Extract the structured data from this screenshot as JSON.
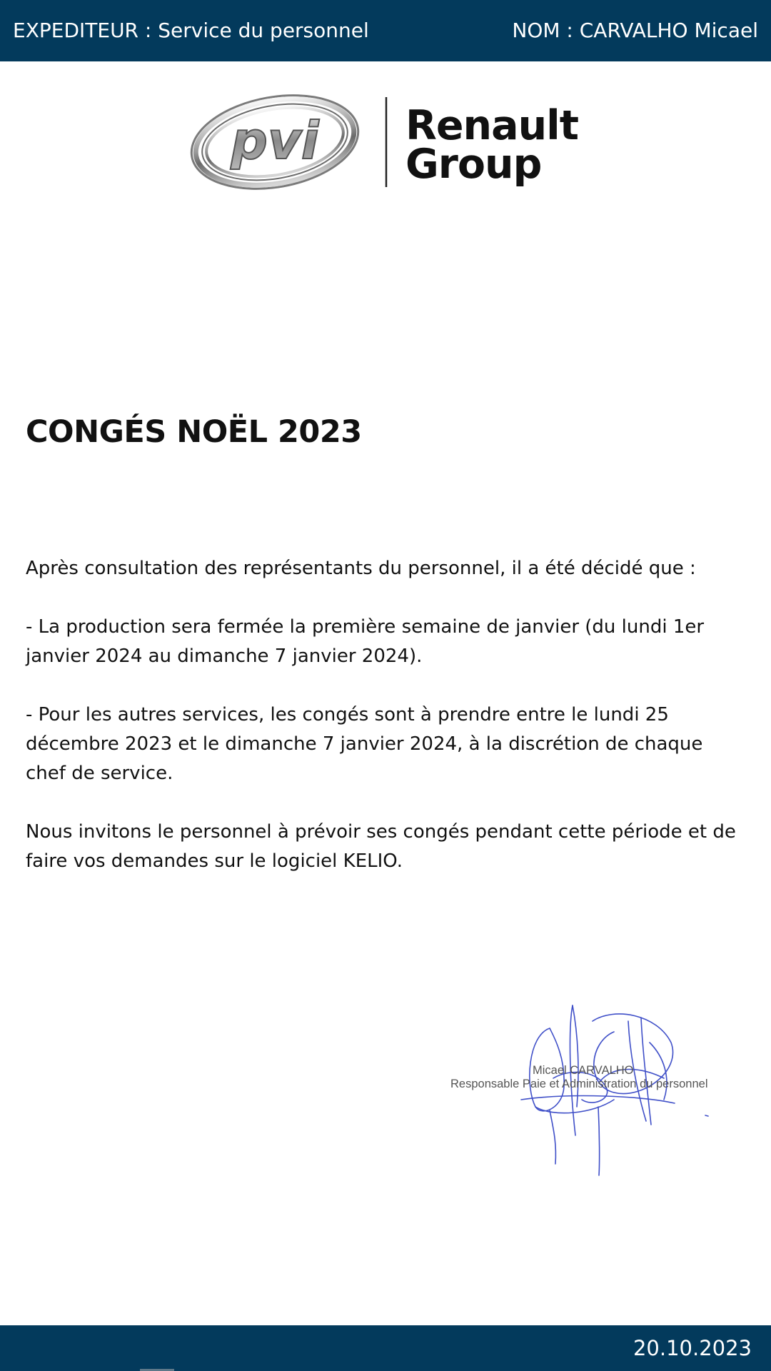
{
  "header": {
    "sender": "EXPEDITEUR : Service du personnel",
    "recipient": "NOM : CARVALHO Micael"
  },
  "logo": {
    "emblem_text": "pvi",
    "brand_line_1": "Renault",
    "brand_line_2": "Group"
  },
  "document": {
    "title": "CONGÉS NOËL 2023",
    "paragraphs": [
      "Après consultation des représentants du personnel, il a été décidé que :",
      "- La production sera fermée la première semaine de janvier (du lundi 1er janvier 2024 au dimanche 7 janvier 2024).",
      "- Pour les autres services, les congés sont à prendre entre le lundi 25 décembre 2023 et le dimanche 7 janvier 2024, à la discrétion de chaque chef de service.",
      "Nous invitons le personnel à prévoir ses congés pendant cette période et de faire vos demandes sur le logiciel KELIO."
    ]
  },
  "signature": {
    "name": "Micael CARVALHO",
    "role": "Responsable Paie et Administration du personnel"
  },
  "footer": {
    "date": "20.10.2023"
  },
  "colors": {
    "bar_background": "#033a5c",
    "bar_text": "#ffffff",
    "body_text": "#111111",
    "signature_ink": "#3f4fc8"
  }
}
